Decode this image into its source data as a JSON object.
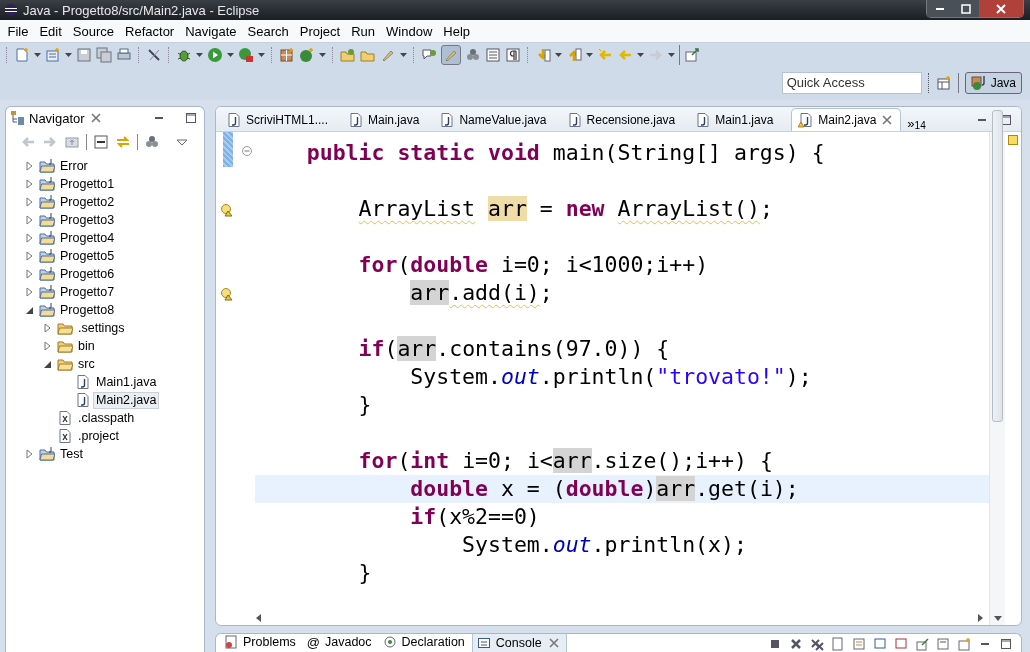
{
  "window": {
    "title": "Java - Progetto8/src/Main2.java - Eclipse"
  },
  "menu": [
    "File",
    "Edit",
    "Source",
    "Refactor",
    "Navigate",
    "Search",
    "Project",
    "Run",
    "Window",
    "Help"
  ],
  "quick_access": {
    "placeholder": "Quick Access"
  },
  "perspectives": [
    {
      "label": "Java",
      "selected": true
    }
  ],
  "navigator": {
    "title": "Navigator",
    "tree": [
      {
        "label": "Error",
        "kind": "project",
        "expanded": false,
        "selected": false
      },
      {
        "label": "Progetto1",
        "kind": "project",
        "expanded": false,
        "selected": false
      },
      {
        "label": "Progetto2",
        "kind": "project",
        "expanded": false,
        "selected": false
      },
      {
        "label": "Progetto3",
        "kind": "project",
        "expanded": false,
        "selected": false
      },
      {
        "label": "Progetto4",
        "kind": "project",
        "expanded": false,
        "selected": false
      },
      {
        "label": "Progetto5",
        "kind": "project",
        "expanded": false,
        "selected": false
      },
      {
        "label": "Progetto6",
        "kind": "project",
        "expanded": false,
        "selected": false
      },
      {
        "label": "Progetto7",
        "kind": "project",
        "expanded": false,
        "selected": false
      },
      {
        "label": "Progetto8",
        "kind": "project",
        "expanded": true,
        "selected": false,
        "children": [
          {
            "label": ".settings",
            "kind": "folder",
            "expanded": false,
            "selected": false
          },
          {
            "label": "bin",
            "kind": "folder",
            "expanded": false,
            "selected": false
          },
          {
            "label": "src",
            "kind": "folder",
            "expanded": true,
            "selected": false,
            "children": [
              {
                "label": "Main1.java",
                "kind": "java",
                "selected": false
              },
              {
                "label": "Main2.java",
                "kind": "java",
                "selected": true
              }
            ]
          },
          {
            "label": ".classpath",
            "kind": "xml",
            "selected": false
          },
          {
            "label": ".project",
            "kind": "xml",
            "selected": false
          }
        ]
      },
      {
        "label": "Test",
        "kind": "project",
        "expanded": false,
        "selected": false
      }
    ]
  },
  "editor": {
    "tabs": [
      {
        "label": "ScriviHTML1....",
        "selected": false,
        "warning": false
      },
      {
        "label": "Main.java",
        "selected": false,
        "warning": false
      },
      {
        "label": "NameValue.java",
        "selected": false,
        "warning": false
      },
      {
        "label": "Recensione.java",
        "selected": false,
        "warning": false
      },
      {
        "label": "Main1.java",
        "selected": false,
        "warning": false
      },
      {
        "label": "Main2.java",
        "selected": true,
        "warning": true
      }
    ],
    "overflow": {
      "symbol": "»",
      "count": "14"
    },
    "lines": [
      {
        "kind": "code",
        "fold": true,
        "warning": false,
        "current": false,
        "tokens": [
          {
            "kind": "kw",
            "text": "    public"
          },
          {
            "kind": "kw",
            "text": " static"
          },
          {
            "kind": "kw",
            "text": " void"
          },
          {
            "kind": "plain",
            "text": " main(String[] args) {"
          }
        ]
      },
      {
        "kind": "blank"
      },
      {
        "kind": "code",
        "fold": false,
        "warning": true,
        "current": false,
        "tokens": [
          {
            "kind": "warn",
            "text": "        ArrayList"
          },
          {
            "kind": "write",
            "text": " arr"
          },
          {
            "kind": "plain",
            "text": " ="
          },
          {
            "kind": "kw",
            "text": " new"
          },
          {
            "kind": "warn",
            "text": " ArrayList()"
          },
          {
            "kind": "plain",
            "text": ";"
          }
        ]
      },
      {
        "kind": "blank"
      },
      {
        "kind": "code",
        "fold": false,
        "warning": false,
        "current": false,
        "tokens": [
          {
            "kind": "kw",
            "text": "        for"
          },
          {
            "kind": "plain",
            "text": "("
          },
          {
            "kind": "kw",
            "text": "double"
          },
          {
            "kind": "plain",
            "text": " i=0; i<1000;i++)"
          }
        ]
      },
      {
        "kind": "code",
        "fold": false,
        "warning": true,
        "current": false,
        "tokens": [
          {
            "kind": "read",
            "text": "            arr"
          },
          {
            "kind": "warn",
            "text": ".add(i)"
          },
          {
            "kind": "plain",
            "text": ";"
          }
        ]
      },
      {
        "kind": "blank"
      },
      {
        "kind": "code",
        "fold": false,
        "warning": false,
        "current": false,
        "tokens": [
          {
            "kind": "kw",
            "text": "        if"
          },
          {
            "kind": "plain",
            "text": "("
          },
          {
            "kind": "read",
            "text": "arr"
          },
          {
            "kind": "plain",
            "text": ".contains(97.0)) {"
          }
        ]
      },
      {
        "kind": "code",
        "fold": false,
        "warning": false,
        "current": false,
        "tokens": [
          {
            "kind": "plain",
            "text": "            System."
          },
          {
            "kind": "static",
            "text": "out"
          },
          {
            "kind": "plain",
            "text": ".println("
          },
          {
            "kind": "str",
            "text": "\"trovato!\""
          },
          {
            "kind": "plain",
            "text": ");"
          }
        ]
      },
      {
        "kind": "code",
        "fold": false,
        "warning": false,
        "current": false,
        "tokens": [
          {
            "kind": "plain",
            "text": "        }"
          }
        ]
      },
      {
        "kind": "blank"
      },
      {
        "kind": "code",
        "fold": false,
        "warning": false,
        "current": false,
        "tokens": [
          {
            "kind": "kw",
            "text": "        for"
          },
          {
            "kind": "plain",
            "text": "("
          },
          {
            "kind": "kw",
            "text": "int"
          },
          {
            "kind": "plain",
            "text": " i=0; i<"
          },
          {
            "kind": "read",
            "text": "arr"
          },
          {
            "kind": "plain",
            "text": ".size();i++) {"
          }
        ]
      },
      {
        "kind": "code",
        "fold": false,
        "warning": false,
        "current": true,
        "tokens": [
          {
            "kind": "kw",
            "text": "            double"
          },
          {
            "kind": "plain",
            "text": " x = ("
          },
          {
            "kind": "kw",
            "text": "double"
          },
          {
            "kind": "plain",
            "text": ")"
          },
          {
            "kind": "read",
            "text": "arr"
          },
          {
            "kind": "plain",
            "text": ".get(i);"
          }
        ]
      },
      {
        "kind": "code",
        "fold": false,
        "warning": false,
        "current": false,
        "tokens": [
          {
            "kind": "kw",
            "text": "            if"
          },
          {
            "kind": "plain",
            "text": "(x%2==0)"
          }
        ]
      },
      {
        "kind": "code",
        "fold": false,
        "warning": false,
        "current": false,
        "tokens": [
          {
            "kind": "plain",
            "text": "                System."
          },
          {
            "kind": "static",
            "text": "out"
          },
          {
            "kind": "plain",
            "text": ".println(x);"
          }
        ]
      },
      {
        "kind": "code",
        "fold": false,
        "warning": false,
        "current": false,
        "tokens": [
          {
            "kind": "plain",
            "text": "        }"
          }
        ]
      }
    ]
  },
  "bottom_panel": {
    "tabs": [
      {
        "label": "Problems",
        "kind": "problems",
        "selected": false
      },
      {
        "label": "Javadoc",
        "kind": "javadoc",
        "icon": "@",
        "selected": false
      },
      {
        "label": "Declaration",
        "kind": "declaration",
        "selected": false
      },
      {
        "label": "Console",
        "kind": "console",
        "selected": true
      }
    ]
  }
}
